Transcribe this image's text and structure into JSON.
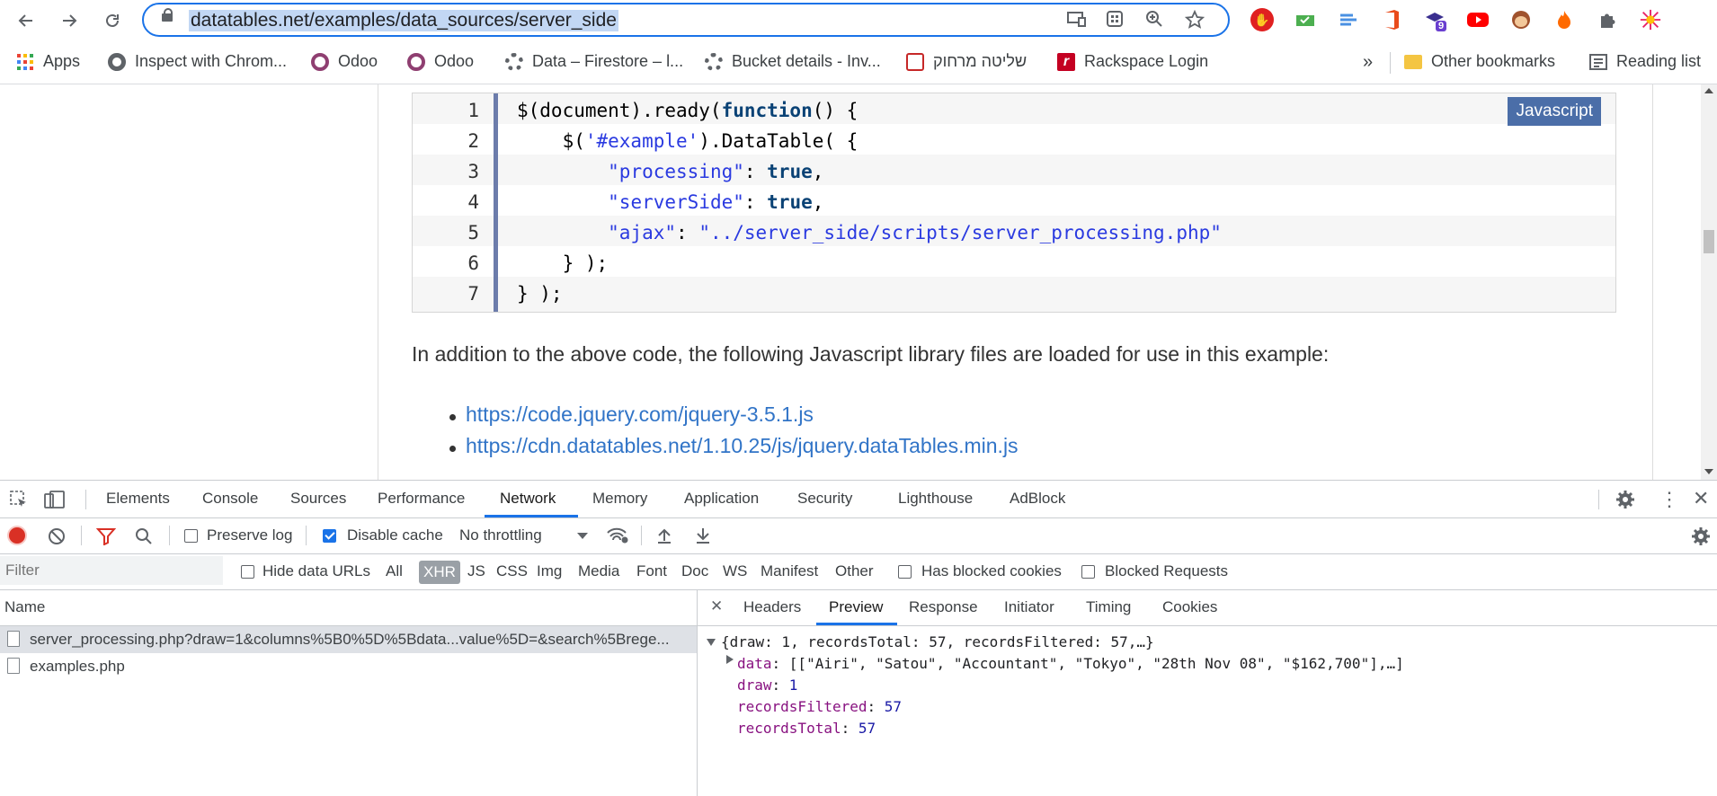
{
  "browser": {
    "url": "datatables.net/examples/data_sources/server_side",
    "ext_badge": "9"
  },
  "bookmarks": {
    "items": [
      {
        "label": "Apps"
      },
      {
        "label": "Inspect with Chrom..."
      },
      {
        "label": "Odoo"
      },
      {
        "label": "Odoo"
      },
      {
        "label": "Data – Firestore – l..."
      },
      {
        "label": "Bucket details - Inv..."
      },
      {
        "label": "שליטה מרחוק"
      },
      {
        "label": "Rackspace Login"
      }
    ],
    "more": "»",
    "other": "Other bookmarks",
    "reading": "Reading list"
  },
  "page": {
    "code_lang": "Javascript",
    "line_numbers": [
      "1",
      "2",
      "3",
      "4",
      "5",
      "6",
      "7"
    ],
    "code": {
      "l1a": "$(document).ready(",
      "l1b": "function",
      "l1c": "() {",
      "l2a": "    $(",
      "l2b": "'#example'",
      "l2c": ").DataTable( {",
      "l3a": "        ",
      "l3b": "\"processing\"",
      "l3c": ": ",
      "l3d": "true",
      "l3e": ",",
      "l4a": "        ",
      "l4b": "\"serverSide\"",
      "l4c": ": ",
      "l4d": "true",
      "l4e": ",",
      "l5a": "        ",
      "l5b": "\"ajax\"",
      "l5c": ": ",
      "l5d": "\"../server_side/scripts/server_processing.php\"",
      "l6": "    } );",
      "l7": "} );"
    },
    "paragraph": "In addition to the above code, the following Javascript library files are loaded for use in this example:",
    "libs": [
      "https://code.jquery.com/jquery-3.5.1.js",
      "https://cdn.datatables.net/1.10.25/js/jquery.dataTables.min.js"
    ]
  },
  "devtools": {
    "tabs": [
      "Elements",
      "Console",
      "Sources",
      "Performance",
      "Network",
      "Memory",
      "Application",
      "Security",
      "Lighthouse",
      "AdBlock"
    ],
    "active_tab": "Network",
    "preserve_log": "Preserve log",
    "disable_cache": "Disable cache",
    "throttling": "No throttling",
    "filter_placeholder": "Filter",
    "hide_data_urls": "Hide data URLs",
    "types": [
      "All",
      "XHR",
      "JS",
      "CSS",
      "Img",
      "Media",
      "Font",
      "Doc",
      "WS",
      "Manifest",
      "Other"
    ],
    "active_type": "XHR",
    "has_blocked_cookies": "Has blocked cookies",
    "blocked_requests": "Blocked Requests",
    "name_header": "Name",
    "requests": [
      "server_processing.php?draw=1&columns%5B0%5D%5Bdata...value%5D=&search%5Brege...",
      "examples.php"
    ],
    "detail_tabs": [
      "Headers",
      "Preview",
      "Response",
      "Initiator",
      "Timing",
      "Cookies"
    ],
    "active_detail": "Preview",
    "preview": {
      "summary": "{draw: 1, recordsTotal: 57, recordsFiltered: 57,…}",
      "data_key": "data",
      "data_val": "[[\"Airi\", \"Satou\", \"Accountant\", \"Tokyo\", \"28th Nov 08\", \"$162,700\"],…]",
      "draw_key": "draw",
      "draw_val": "1",
      "rf_key": "recordsFiltered",
      "rf_val": "57",
      "rt_key": "recordsTotal",
      "rt_val": "57"
    }
  }
}
